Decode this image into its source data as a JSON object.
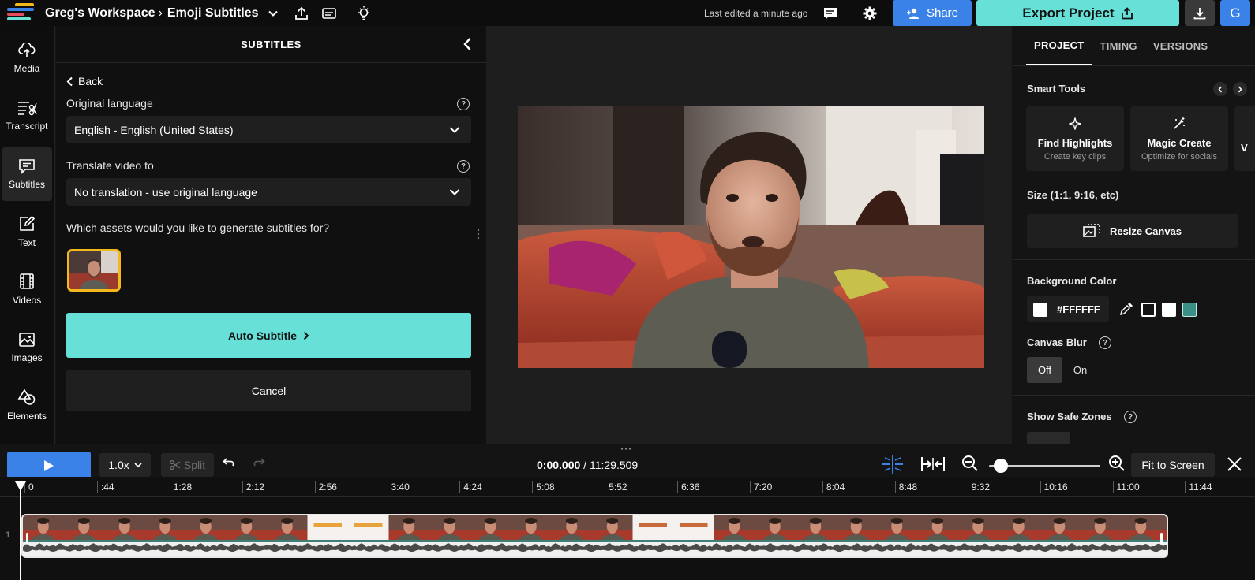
{
  "header": {
    "workspace": "Greg's Workspace",
    "separator": "›",
    "project": "Emoji Subtitles",
    "last_edited": "Last edited a minute ago",
    "share_label": "Share",
    "export_label": "Export Project",
    "avatar_initial": "G",
    "logo_colors": [
      "#f2b81c",
      "#3a82e8",
      "#e84a5f",
      "#67e0d8"
    ]
  },
  "rail": {
    "items": [
      {
        "label": "Media",
        "icon": "upload-cloud-icon"
      },
      {
        "label": "Transcript",
        "icon": "transcript-icon"
      },
      {
        "label": "Subtitles",
        "icon": "subtitles-icon"
      },
      {
        "label": "Text",
        "icon": "text-edit-icon"
      },
      {
        "label": "Videos",
        "icon": "film-icon"
      },
      {
        "label": "Images",
        "icon": "image-icon"
      },
      {
        "label": "Elements",
        "icon": "shapes-icon"
      }
    ],
    "active": "Subtitles"
  },
  "panel": {
    "title": "SUBTITLES",
    "back_label": "Back",
    "original_language_label": "Original language",
    "original_language_value": "English - English (United States)",
    "translate_label": "Translate video to",
    "translate_value": "No translation - use original language",
    "assets_question": "Which assets would you like to generate subtitles for?",
    "auto_subtitle_label": "Auto Subtitle",
    "cancel_label": "Cancel"
  },
  "right": {
    "tabs": [
      "PROJECT",
      "TIMING",
      "VERSIONS"
    ],
    "active_tab": "PROJECT",
    "smart_tools_title": "Smart Tools",
    "tools": [
      {
        "title": "Find Highlights",
        "subtitle": "Create key clips",
        "icon": "sparkle-icon"
      },
      {
        "title": "Magic Create",
        "subtitle": "Optimize for socials",
        "icon": "magic-wand-icon"
      },
      {
        "title": "V",
        "subtitle": "",
        "icon": ""
      }
    ],
    "size_title": "Size (1:1, 9:16, etc)",
    "resize_label": "Resize Canvas",
    "bg_color_title": "Background Color",
    "bg_color_value": "#FFFFFF",
    "swatches": [
      "#141414",
      "#FFFFFF",
      "#3a8f86"
    ],
    "canvas_blur_title": "Canvas Blur",
    "blur_off": "Off",
    "blur_on": "On",
    "safe_zones_title": "Show Safe Zones"
  },
  "timeline": {
    "speed": "1.0x",
    "split_label": "Split",
    "current_time": "0:00.000",
    "time_separator": " / ",
    "total_time": "11:29.509",
    "zoom_level": 0.05,
    "fit_label": "Fit to Screen",
    "track_number": "1",
    "ruler_ticks": [
      "0",
      ":44",
      "1:28",
      "2:12",
      "2:56",
      "3:40",
      "4:24",
      "5:08",
      "5:52",
      "6:36",
      "7:20",
      "8:04",
      "8:48",
      "9:32",
      "10:16",
      "11:00",
      "11:44"
    ]
  }
}
